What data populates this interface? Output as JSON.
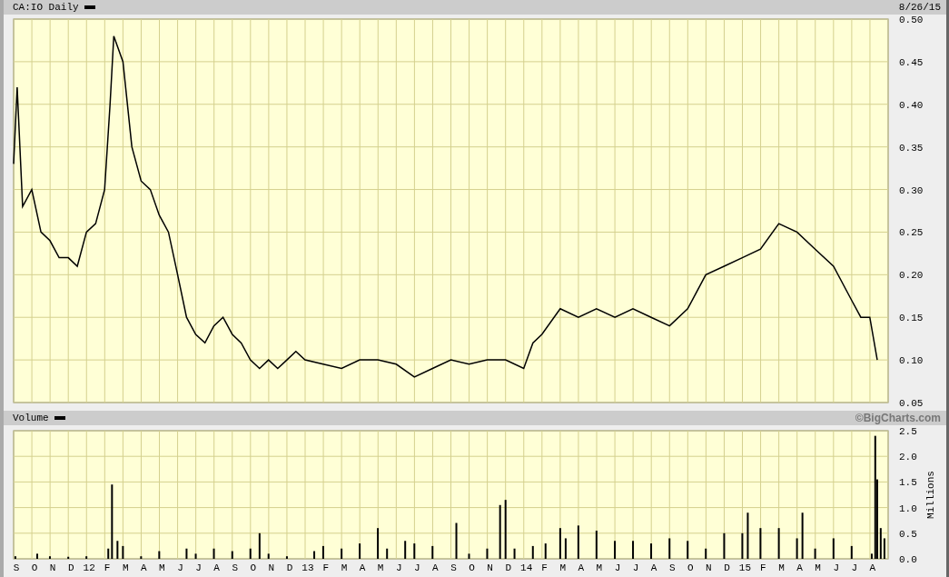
{
  "header": {
    "title": "CA:IO Daily",
    "date": "8/26/15"
  },
  "price_chart": {
    "chart_data": {
      "type": "line",
      "grid": true,
      "xlim": [
        11.667,
        15.667
      ],
      "ylim": [
        0.05,
        0.5
      ],
      "yticks": [
        {
          "value": 0.05,
          "label": "0.05"
        },
        {
          "value": 0.1,
          "label": "0.10"
        },
        {
          "value": 0.15,
          "label": "0.15"
        },
        {
          "value": 0.2,
          "label": "0.20"
        },
        {
          "value": 0.25,
          "label": "0.25"
        },
        {
          "value": 0.3,
          "label": "0.30"
        },
        {
          "value": 0.35,
          "label": "0.35"
        },
        {
          "value": 0.4,
          "label": "0.40"
        },
        {
          "value": 0.45,
          "label": "0.45"
        },
        {
          "value": 0.5,
          "label": "0.50"
        }
      ],
      "x": [
        11.667,
        11.683,
        11.708,
        11.75,
        11.792,
        11.833,
        11.875,
        11.917,
        11.958,
        12,
        12.042,
        12.083,
        12.108,
        12.125,
        12.167,
        12.208,
        12.25,
        12.292,
        12.333,
        12.375,
        12.417,
        12.458,
        12.5,
        12.542,
        12.583,
        12.625,
        12.667,
        12.708,
        12.75,
        12.792,
        12.833,
        12.875,
        12.917,
        12.958,
        13,
        13.083,
        13.167,
        13.25,
        13.333,
        13.417,
        13.5,
        13.583,
        13.667,
        13.75,
        13.833,
        13.917,
        14,
        14.042,
        14.083,
        14.167,
        14.25,
        14.333,
        14.417,
        14.5,
        14.583,
        14.667,
        14.75,
        14.833,
        14.917,
        15,
        15.083,
        15.167,
        15.25,
        15.333,
        15.417,
        15.5,
        15.542,
        15.583,
        15.617
      ],
      "series": [
        {
          "color": "#000000",
          "values": [
            0.33,
            0.42,
            0.28,
            0.3,
            0.25,
            0.24,
            0.22,
            0.22,
            0.21,
            0.25,
            0.26,
            0.3,
            0.4,
            0.48,
            0.45,
            0.35,
            0.31,
            0.3,
            0.27,
            0.25,
            0.2,
            0.15,
            0.13,
            0.12,
            0.14,
            0.15,
            0.13,
            0.12,
            0.1,
            0.09,
            0.1,
            0.09,
            0.1,
            0.11,
            0.1,
            0.095,
            0.09,
            0.1,
            0.1,
            0.095,
            0.08,
            0.09,
            0.1,
            0.095,
            0.1,
            0.1,
            0.09,
            0.12,
            0.13,
            0.16,
            0.15,
            0.16,
            0.15,
            0.16,
            0.15,
            0.14,
            0.16,
            0.2,
            0.21,
            0.22,
            0.23,
            0.26,
            0.25,
            0.23,
            0.21,
            0.17,
            0.15,
            0.15,
            0.1
          ]
        }
      ]
    }
  },
  "volume_panel": {
    "title": "Volume",
    "credit": "©BigCharts.com",
    "chart_data": {
      "type": "bar",
      "grid": true,
      "ylabel": "Millions",
      "xlim": [
        11.667,
        15.667
      ],
      "ylim": [
        0,
        2.5
      ],
      "yticks": [
        {
          "value": 0,
          "label": "0.0"
        },
        {
          "value": 0.5,
          "label": "0.5"
        },
        {
          "value": 1,
          "label": "1.0"
        },
        {
          "value": 1.5,
          "label": "1.5"
        },
        {
          "value": 2,
          "label": "2.0"
        },
        {
          "value": 2.5,
          "label": "2.5"
        }
      ],
      "xticks": [
        {
          "value": 11.667,
          "label": "S"
        },
        {
          "value": 11.75,
          "label": "O"
        },
        {
          "value": 11.833,
          "label": "N"
        },
        {
          "value": 11.917,
          "label": "D"
        },
        {
          "value": 12,
          "label": "12"
        },
        {
          "value": 12.083,
          "label": "F"
        },
        {
          "value": 12.167,
          "label": "M"
        },
        {
          "value": 12.25,
          "label": "A"
        },
        {
          "value": 12.333,
          "label": "M"
        },
        {
          "value": 12.417,
          "label": "J"
        },
        {
          "value": 12.5,
          "label": "J"
        },
        {
          "value": 12.583,
          "label": "A"
        },
        {
          "value": 12.667,
          "label": "S"
        },
        {
          "value": 12.75,
          "label": "O"
        },
        {
          "value": 12.833,
          "label": "N"
        },
        {
          "value": 12.917,
          "label": "D"
        },
        {
          "value": 13,
          "label": "13"
        },
        {
          "value": 13.083,
          "label": "F"
        },
        {
          "value": 13.167,
          "label": "M"
        },
        {
          "value": 13.25,
          "label": "A"
        },
        {
          "value": 13.333,
          "label": "M"
        },
        {
          "value": 13.417,
          "label": "J"
        },
        {
          "value": 13.5,
          "label": "J"
        },
        {
          "value": 13.583,
          "label": "A"
        },
        {
          "value": 13.667,
          "label": "S"
        },
        {
          "value": 13.75,
          "label": "O"
        },
        {
          "value": 13.833,
          "label": "N"
        },
        {
          "value": 13.917,
          "label": "D"
        },
        {
          "value": 14,
          "label": "14"
        },
        {
          "value": 14.083,
          "label": "F"
        },
        {
          "value": 14.167,
          "label": "M"
        },
        {
          "value": 14.25,
          "label": "A"
        },
        {
          "value": 14.333,
          "label": "M"
        },
        {
          "value": 14.417,
          "label": "J"
        },
        {
          "value": 14.5,
          "label": "J"
        },
        {
          "value": 14.583,
          "label": "A"
        },
        {
          "value": 14.667,
          "label": "S"
        },
        {
          "value": 14.75,
          "label": "O"
        },
        {
          "value": 14.833,
          "label": "N"
        },
        {
          "value": 14.917,
          "label": "D"
        },
        {
          "value": 15,
          "label": "15"
        },
        {
          "value": 15.083,
          "label": "F"
        },
        {
          "value": 15.167,
          "label": "M"
        },
        {
          "value": 15.25,
          "label": "A"
        },
        {
          "value": 15.333,
          "label": "M"
        },
        {
          "value": 15.417,
          "label": "J"
        },
        {
          "value": 15.5,
          "label": "J"
        },
        {
          "value": 15.583,
          "label": "A"
        }
      ],
      "x": [
        11.675,
        11.775,
        11.833,
        11.917,
        12,
        12.1,
        12.117,
        12.142,
        12.167,
        12.25,
        12.333,
        12.458,
        12.5,
        12.583,
        12.667,
        12.75,
        12.792,
        12.833,
        12.917,
        13.042,
        13.083,
        13.167,
        13.25,
        13.333,
        13.375,
        13.458,
        13.5,
        13.583,
        13.692,
        13.75,
        13.833,
        13.892,
        13.917,
        13.958,
        14.042,
        14.1,
        14.167,
        14.192,
        14.25,
        14.333,
        14.417,
        14.5,
        14.583,
        14.667,
        14.75,
        14.833,
        14.917,
        15,
        15.025,
        15.083,
        15.167,
        15.25,
        15.275,
        15.333,
        15.417,
        15.5,
        15.592,
        15.608,
        15.617,
        15.633,
        15.65
      ],
      "series": [
        {
          "color": "#000000",
          "values": [
            0.05,
            0.1,
            0.05,
            0.04,
            0.05,
            0.2,
            1.45,
            0.35,
            0.25,
            0.05,
            0.15,
            0.2,
            0.1,
            0.2,
            0.15,
            0.2,
            0.5,
            0.1,
            0.05,
            0.15,
            0.25,
            0.2,
            0.3,
            0.6,
            0.2,
            0.35,
            0.3,
            0.25,
            0.7,
            0.1,
            0.2,
            1.05,
            1.15,
            0.2,
            0.25,
            0.3,
            0.6,
            0.4,
            0.65,
            0.55,
            0.35,
            0.35,
            0.3,
            0.4,
            0.35,
            0.2,
            0.5,
            0.5,
            0.9,
            0.6,
            0.6,
            0.4,
            0.9,
            0.2,
            0.4,
            0.25,
            0.1,
            2.4,
            1.55,
            0.6,
            0.4
          ]
        }
      ]
    }
  }
}
